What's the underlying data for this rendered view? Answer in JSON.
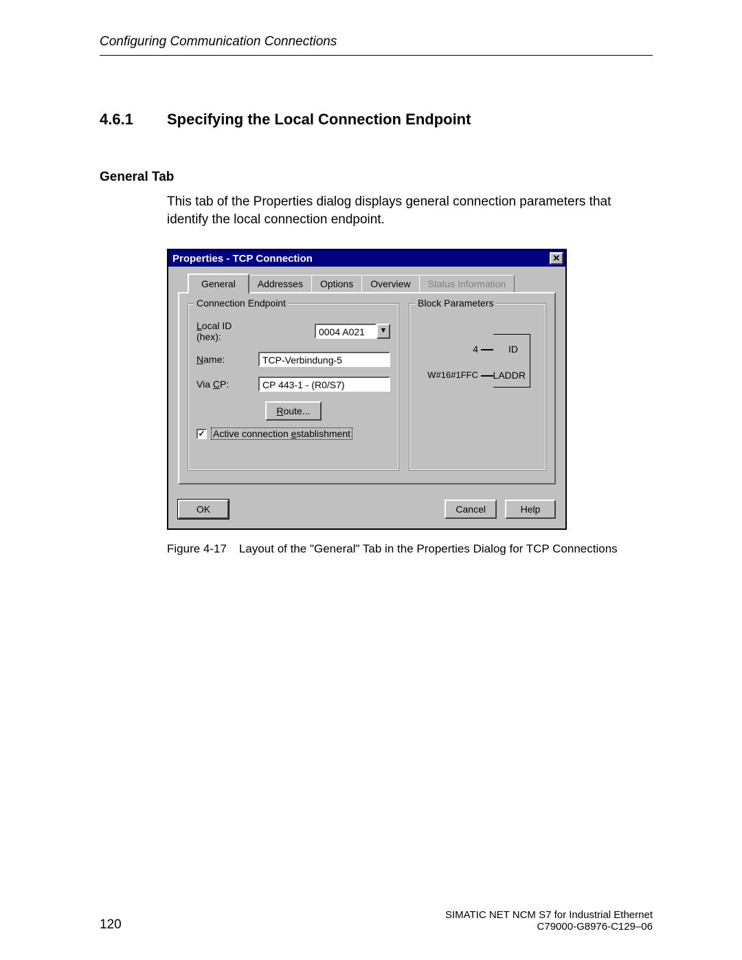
{
  "header": {
    "running_head": "Configuring Communication Connections"
  },
  "section": {
    "number": "4.6.1",
    "title": "Specifying the Local Connection Endpoint",
    "sub_heading": "General Tab",
    "paragraph": "This tab of the Properties dialog displays general connection parameters that identify the local connection endpoint."
  },
  "dialog": {
    "title": "Properties - TCP Connection",
    "close_glyph": "✕",
    "tabs": {
      "general": "General",
      "addresses": "Addresses",
      "options": "Options",
      "overview": "Overview",
      "status": "Status Information"
    },
    "group_endpoint": {
      "title": "Connection Endpoint",
      "local_id_label_pre": "L",
      "local_id_label_post": "ocal ID (hex):",
      "local_id_value": "0004 A021",
      "name_label_pre": "N",
      "name_label_post": "ame:",
      "name_value": "TCP-Verbindung-5",
      "via_cp_label_pre": "Via ",
      "via_cp_label_u": "C",
      "via_cp_label_post": "P:",
      "via_cp_value": "CP 443-1 - (R0/S7)",
      "route_btn_pre": "R",
      "route_btn_post": "oute...",
      "checkbox_mark": "✓",
      "checkbox_label_pre": "Active connection ",
      "checkbox_label_u": "e",
      "checkbox_label_post": "stablishment"
    },
    "group_block": {
      "title": "Block Parameters",
      "id_value": "4",
      "id_label": "ID",
      "laddr_value": "W#16#1FFC",
      "laddr_label": "LADDR"
    },
    "buttons": {
      "ok": "OK",
      "cancel": "Cancel",
      "help": "Help"
    }
  },
  "figure": {
    "label": "Figure 4-17",
    "caption": "Layout of the \"General\" Tab in the Properties Dialog for TCP Connections"
  },
  "footer": {
    "page_number": "120",
    "product_line": "SIMATIC NET NCM S7 for Industrial Ethernet",
    "doc_id": "C79000-G8976-C129–06"
  }
}
